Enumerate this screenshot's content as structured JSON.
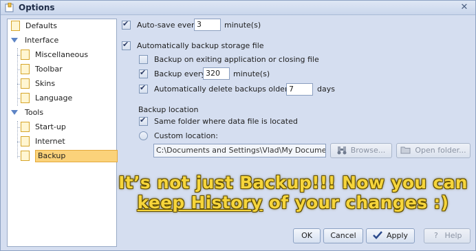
{
  "window": {
    "title": "Options"
  },
  "tree": {
    "items": [
      {
        "label": "Defaults"
      },
      {
        "label": "Interface"
      },
      {
        "label": "Miscellaneous"
      },
      {
        "label": "Toolbar"
      },
      {
        "label": "Skins"
      },
      {
        "label": "Language"
      },
      {
        "label": "Tools"
      },
      {
        "label": "Start-up"
      },
      {
        "label": "Internet"
      },
      {
        "label": "Backup"
      }
    ],
    "selected": "Backup"
  },
  "settings": {
    "autosave_label": "Auto-save every",
    "autosave_value": "3",
    "autosave_unit": "minute(s)",
    "auto_backup_label": "Automatically backup storage file",
    "backup_on_exit_label": "Backup on exiting application or closing file",
    "backup_every_label": "Backup every",
    "backup_every_value": "320",
    "backup_every_unit": "minute(s)",
    "auto_delete_label": "Automatically delete backups older then",
    "auto_delete_value": "7",
    "auto_delete_unit": "days",
    "backup_location_label": "Backup location",
    "same_folder_label": "Same folder where data file is located",
    "custom_location_label": "Custom location:",
    "custom_path": "C:\\Documents and Settings\\Vlad\\My Documents\\",
    "browse_label": "Browse...",
    "open_folder_label": "Open folder..."
  },
  "promo": {
    "line1": "It’s not just Backup!!! Now you can",
    "line2_underlined": "keep History",
    "line2_rest": " of your changes :)"
  },
  "buttons": {
    "ok": "OK",
    "cancel": "Cancel",
    "apply": "Apply",
    "help": "Help"
  },
  "colors": {
    "window_bg": "#d5def0",
    "selection": "#fbd27a",
    "promo_text": "#f6d53b"
  }
}
